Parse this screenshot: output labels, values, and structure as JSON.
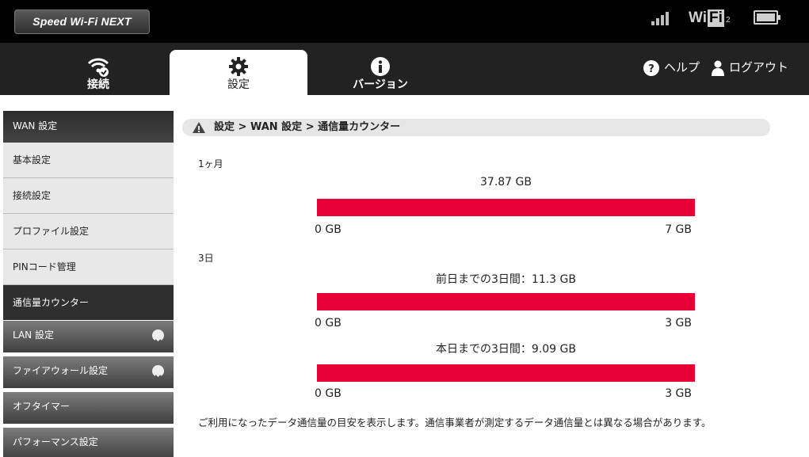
{
  "header": {
    "logo_text": "Speed Wi-Fi NEXT",
    "wifi_label_prefix": "Wi",
    "wifi_label_box": "Fi",
    "wifi_label_suffix": "2"
  },
  "nav": {
    "tabs": [
      {
        "label": "接続",
        "icon": "wifi-check-icon"
      },
      {
        "label": "設定",
        "icon": "gear-icon",
        "active": true
      },
      {
        "label": "バージョン",
        "icon": "info-icon"
      }
    ],
    "help_label": "ヘルプ",
    "logout_label": "ログアウト"
  },
  "sidebar": {
    "wan_header": "WAN 設定",
    "wan_items": [
      "基本設定",
      "接続設定",
      "プロファイル設定",
      "PINコード管理",
      "通信量カウンター"
    ],
    "active_item": "通信量カウンター",
    "groups": [
      "LAN 設定",
      "ファイアウォール設定",
      "オフタイマー",
      "パフォーマンス設定"
    ]
  },
  "breadcrumb": "設定 > WAN 設定 > 通信量カウンター",
  "counter": {
    "month_label": "1ヶ月",
    "month_usage": "37.87 GB",
    "month_min": "0 GB",
    "month_max": "7 GB",
    "month_fill": 1.0,
    "three_day_label": "3日",
    "prev3_usage": "前日までの3日間：11.3 GB",
    "prev3_min": "0 GB",
    "prev3_max": "3 GB",
    "prev3_fill": 1.0,
    "today3_usage": "本日までの3日間：9.09 GB",
    "today3_min": "0 GB",
    "today3_max": "3 GB",
    "today3_fill": 1.0
  },
  "note": "ご利用になったデータ通信量の目安を表示します。通信事業者が測定するデータ通信量とは異なる場合があります。",
  "colors": {
    "bar_fill": "#e60033",
    "nav_bg": "#222222",
    "top_bg": "#000000"
  }
}
